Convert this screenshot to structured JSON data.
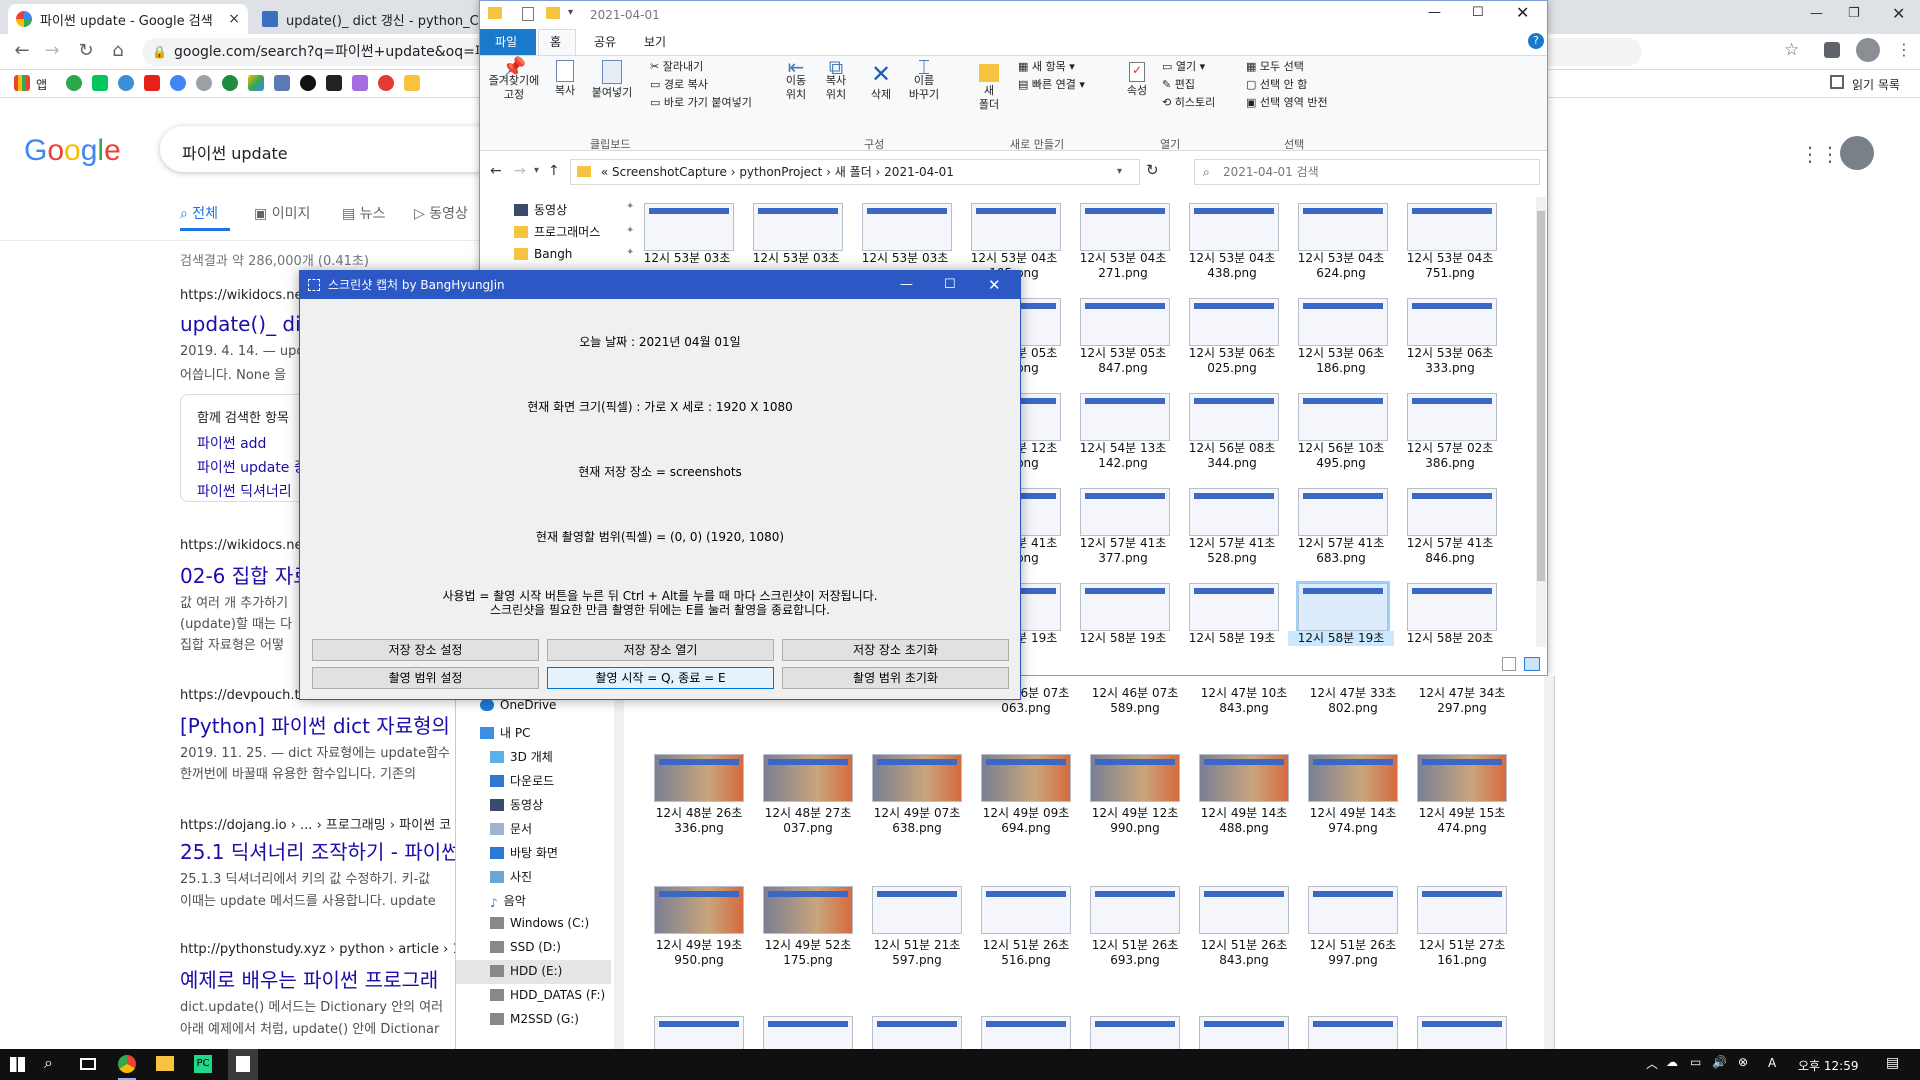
{
  "chrome": {
    "tabs": [
      {
        "title": "파이썬 update - Google 검색",
        "close": "×"
      },
      {
        "title": "update()_ dict 갱신 - python_C",
        "close": "×"
      }
    ],
    "url": "google.com/search?q=파이썬+update&oq=파이",
    "bookmark_label": "앱",
    "reading_list": "읽기 목록"
  },
  "google": {
    "logo": "Google",
    "query": "파이썬 update",
    "tabs": [
      "전체",
      "이미지",
      "뉴스",
      "동영상"
    ],
    "result_stats": "검색결과 약 286,000개 (0.41초)",
    "results": [
      {
        "url": "https://wikidocs.net",
        "title": "update()_ dict",
        "date_desc": "2019. 4. 14. — upd",
        "desc2": "어씁니다. None 을"
      },
      {
        "url": "https://wikidocs.net",
        "title": "02-6 집합 자료",
        "desc1": "값 여러 개 추가하기",
        "desc2": "(update)할 때는 다",
        "desc3": "집합 자료형은 어떻"
      },
      {
        "url": "https://devpouch.tis",
        "title": "[Python] 파이썬 dict 자료형의 u",
        "desc1": "2019. 11. 25. — dict 자료형에는 update함수",
        "desc2": "한꺼번에 바꿀때 유용한 함수입니다. 기존의"
      },
      {
        "url": "https://dojang.io › ... › 프로그래밍 › 파이썬 코",
        "title": "25.1 딕셔너리 조작하기 - 파이썬",
        "desc1": "25.1.3 딕셔너리에서 키의 값 수정하기. 키-값",
        "desc2": "이때는 update 메서드를 사용합니다. update"
      },
      {
        "url": "http://pythonstudy.xyz › python › article › 14-",
        "title": "예제로 배우는 파이썬 프로그래",
        "desc1": "dict.update() 메서드는 Dictionary 안의 여러",
        "desc2": "아래 예제에서 처럼, update() 안에 Dictionar"
      }
    ],
    "related": {
      "header": "함께 검색한 항목",
      "items": [
        "파이썬 add",
        "파이썬 update 중",
        "파이썬 딕셔너리"
      ]
    }
  },
  "explorer": {
    "title": "2021-04-01",
    "ribbon_tabs": [
      "파일",
      "홈",
      "공유",
      "보기"
    ],
    "ribbon": {
      "pin": "즐겨찾기에\n고정",
      "copy": "복사",
      "paste": "붙여넣기",
      "cut": "잘라내기",
      "copy_path": "경로 복사",
      "paste_shortcut": "바로 가기 붙여넣기",
      "move_to": "이동\n위치",
      "copy_to": "복사\n위치",
      "delete": "삭제",
      "rename": "이름\n바꾸기",
      "new_folder": "새\n폴더",
      "new_item": "새 항목",
      "easy_access": "빠른 연결",
      "properties": "속성",
      "open": "열기",
      "edit": "편집",
      "history": "히스토리",
      "select_all": "모두 선택",
      "select_none": "선택 안 함",
      "invert": "선택 영역 반전",
      "groups": [
        "클립보드",
        "구성",
        "새로 만들기",
        "열기",
        "선택"
      ]
    },
    "breadcrumb": [
      "«",
      "ScreenshotCapture",
      "pythonProject",
      "새 폴더",
      "2021-04-01"
    ],
    "search_placeholder": "2021-04-01 검색",
    "nav_pinned": [
      "동영상",
      "프로그래머스",
      "Bangh"
    ],
    "nav_tree": [
      "OneDrive",
      "내 PC",
      "3D 개체",
      "다운로드",
      "동영상",
      "문서",
      "바탕 화면",
      "사진",
      "음악",
      "Windows (C:)",
      "SSD (D:)",
      "HDD (E:)",
      "HDD_DATAS (F:)",
      "M2SSD (G:)"
    ],
    "files_top": [
      [
        "12시 53분 03초",
        "12시 53분 03초",
        "12시 53분 03초",
        "12시 53분 04초\n105.png",
        "12시 53분 04초\n271.png",
        "12시 53분 04초\n438.png",
        "12시 53분 04초\n624.png",
        "12시 53분 04초\n751.png"
      ],
      [
        "",
        "",
        "",
        "12시 53분 05초\n666.png",
        "12시 53분 05초\n847.png",
        "12시 53분 06초\n025.png",
        "12시 53분 06초\n186.png",
        "12시 53분 06초\n333.png"
      ],
      [
        "",
        "",
        "",
        "12시 54분 12초\n439.png",
        "12시 54분 13초\n142.png",
        "12시 56분 08초\n344.png",
        "12시 56분 10초\n495.png",
        "12시 57분 02초\n386.png"
      ],
      [
        "",
        "",
        "",
        "12시 57분 41초\n225.png",
        "12시 57분 41초\n377.png",
        "12시 57분 41초\n528.png",
        "12시 57분 41초\n683.png",
        "12시 57분 41초\n846.png"
      ],
      [
        "",
        "",
        "",
        "12시 58분 19초",
        "12시 58분 19초",
        "12시 58분 19초",
        "12시 58분 19초",
        "12시 58분 20초"
      ]
    ],
    "files_bottom": [
      [
        "800.png",
        "117.png",
        "513.png",
        "12시 46분 07초\n063.png",
        "12시 46분 07초\n589.png",
        "12시 47분 10초\n843.png",
        "12시 47분 33초\n802.png",
        "12시 47분 34초\n297.png"
      ],
      [
        "12시 48분 26초\n336.png",
        "12시 48분 27초\n037.png",
        "12시 49분 07초\n638.png",
        "12시 49분 09초\n694.png",
        "12시 49분 12초\n990.png",
        "12시 49분 14초\n488.png",
        "12시 49분 14초\n974.png",
        "12시 49분 15초\n474.png"
      ],
      [
        "12시 49분 19초\n950.png",
        "12시 49분 52초\n175.png",
        "12시 51분 21초\n597.png",
        "12시 51분 26초\n516.png",
        "12시 51분 26초\n693.png",
        "12시 51분 26초\n843.png",
        "12시 51분 26초\n997.png",
        "12시 51분 27초\n161.png"
      ]
    ]
  },
  "dialog": {
    "title": "스크린샷 캡처 by BangHyungJin",
    "today": "오늘 날짜 : 2021년 04월 01일",
    "screen_size": "현재 화면 크기(픽셀) : 가로 X 세로 : 1920 X 1080",
    "save_location": "현재 저장 장소 = screenshots",
    "capture_range": "현재 촬영할 범위(픽셀) = (0, 0) (1920, 1080)",
    "usage1": "사용법 = 촬영 시작 버튼을 누른 뒤 Ctrl + Alt를 누를 때 마다 스크린샷이 저장됩니다.",
    "usage2": "스크린샷을 필요한 만큼 촬영한 뒤에는 E를 눌러 촬영을 종료합니다.",
    "buttons": [
      "저장 장소 설정",
      "저장 장소 열기",
      "저장 장소 초기화",
      "촬영 범위 설정",
      "촬영 시작 = Q,  종료 = E",
      "촬영 범위 초기화"
    ]
  },
  "taskbar": {
    "time": "오후 12:59",
    "ime": "A"
  },
  "colors": {
    "google_link": "#1a0dab",
    "dialog_title": "#2b58c5",
    "explorer_tab": "#1979ca"
  }
}
